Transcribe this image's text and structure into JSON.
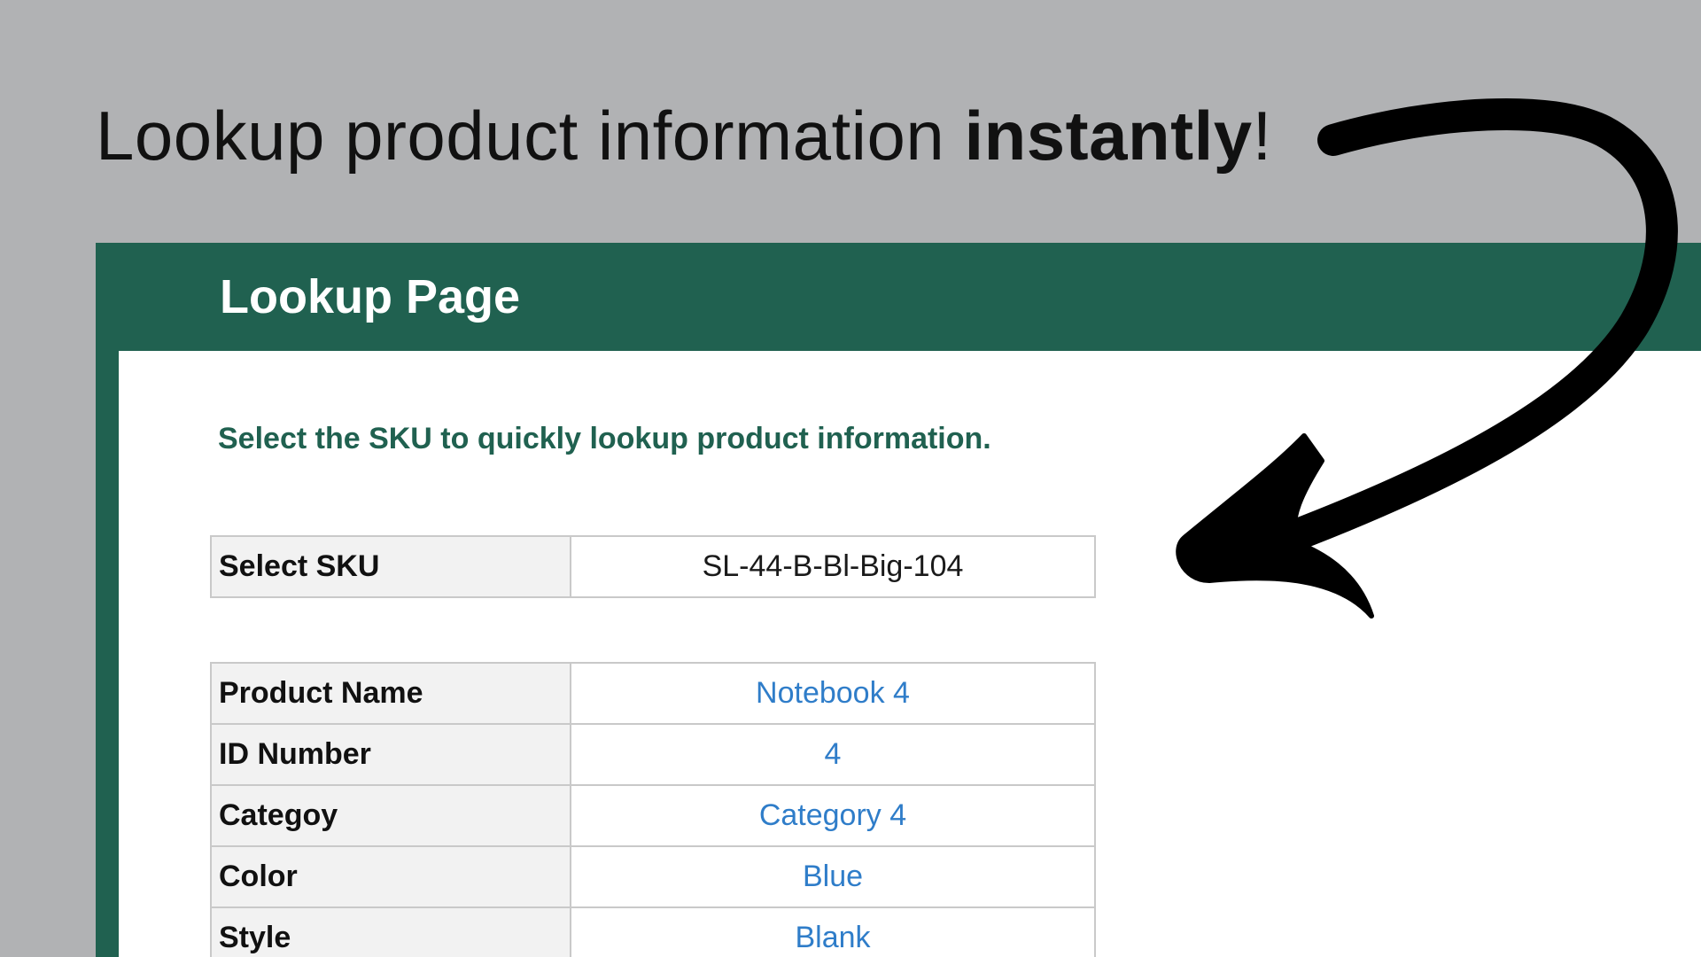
{
  "headline": {
    "prefix": "Lookup product information ",
    "emphasis": "instantly",
    "suffix": "!"
  },
  "sheet": {
    "title": "Lookup Page",
    "instruction": "Select the SKU to quickly lookup product information.",
    "sku": {
      "label": "Select SKU",
      "value": "SL-44-B-Bl-Big-104"
    },
    "fields": [
      {
        "label": "Product Name",
        "value": "Notebook 4"
      },
      {
        "label": "ID Number",
        "value": "4"
      },
      {
        "label": "Categoy",
        "value": "Category 4"
      },
      {
        "label": "Color",
        "value": "Blue"
      },
      {
        "label": "Style",
        "value": "Blank"
      }
    ]
  },
  "colors": {
    "background": "#b1b2b4",
    "header_green": "#206150",
    "value_blue": "#2f7dc9",
    "label_fill": "#f2f2f2",
    "arrow": "#000000"
  },
  "icons": [
    "curved-arrow-icon"
  ]
}
